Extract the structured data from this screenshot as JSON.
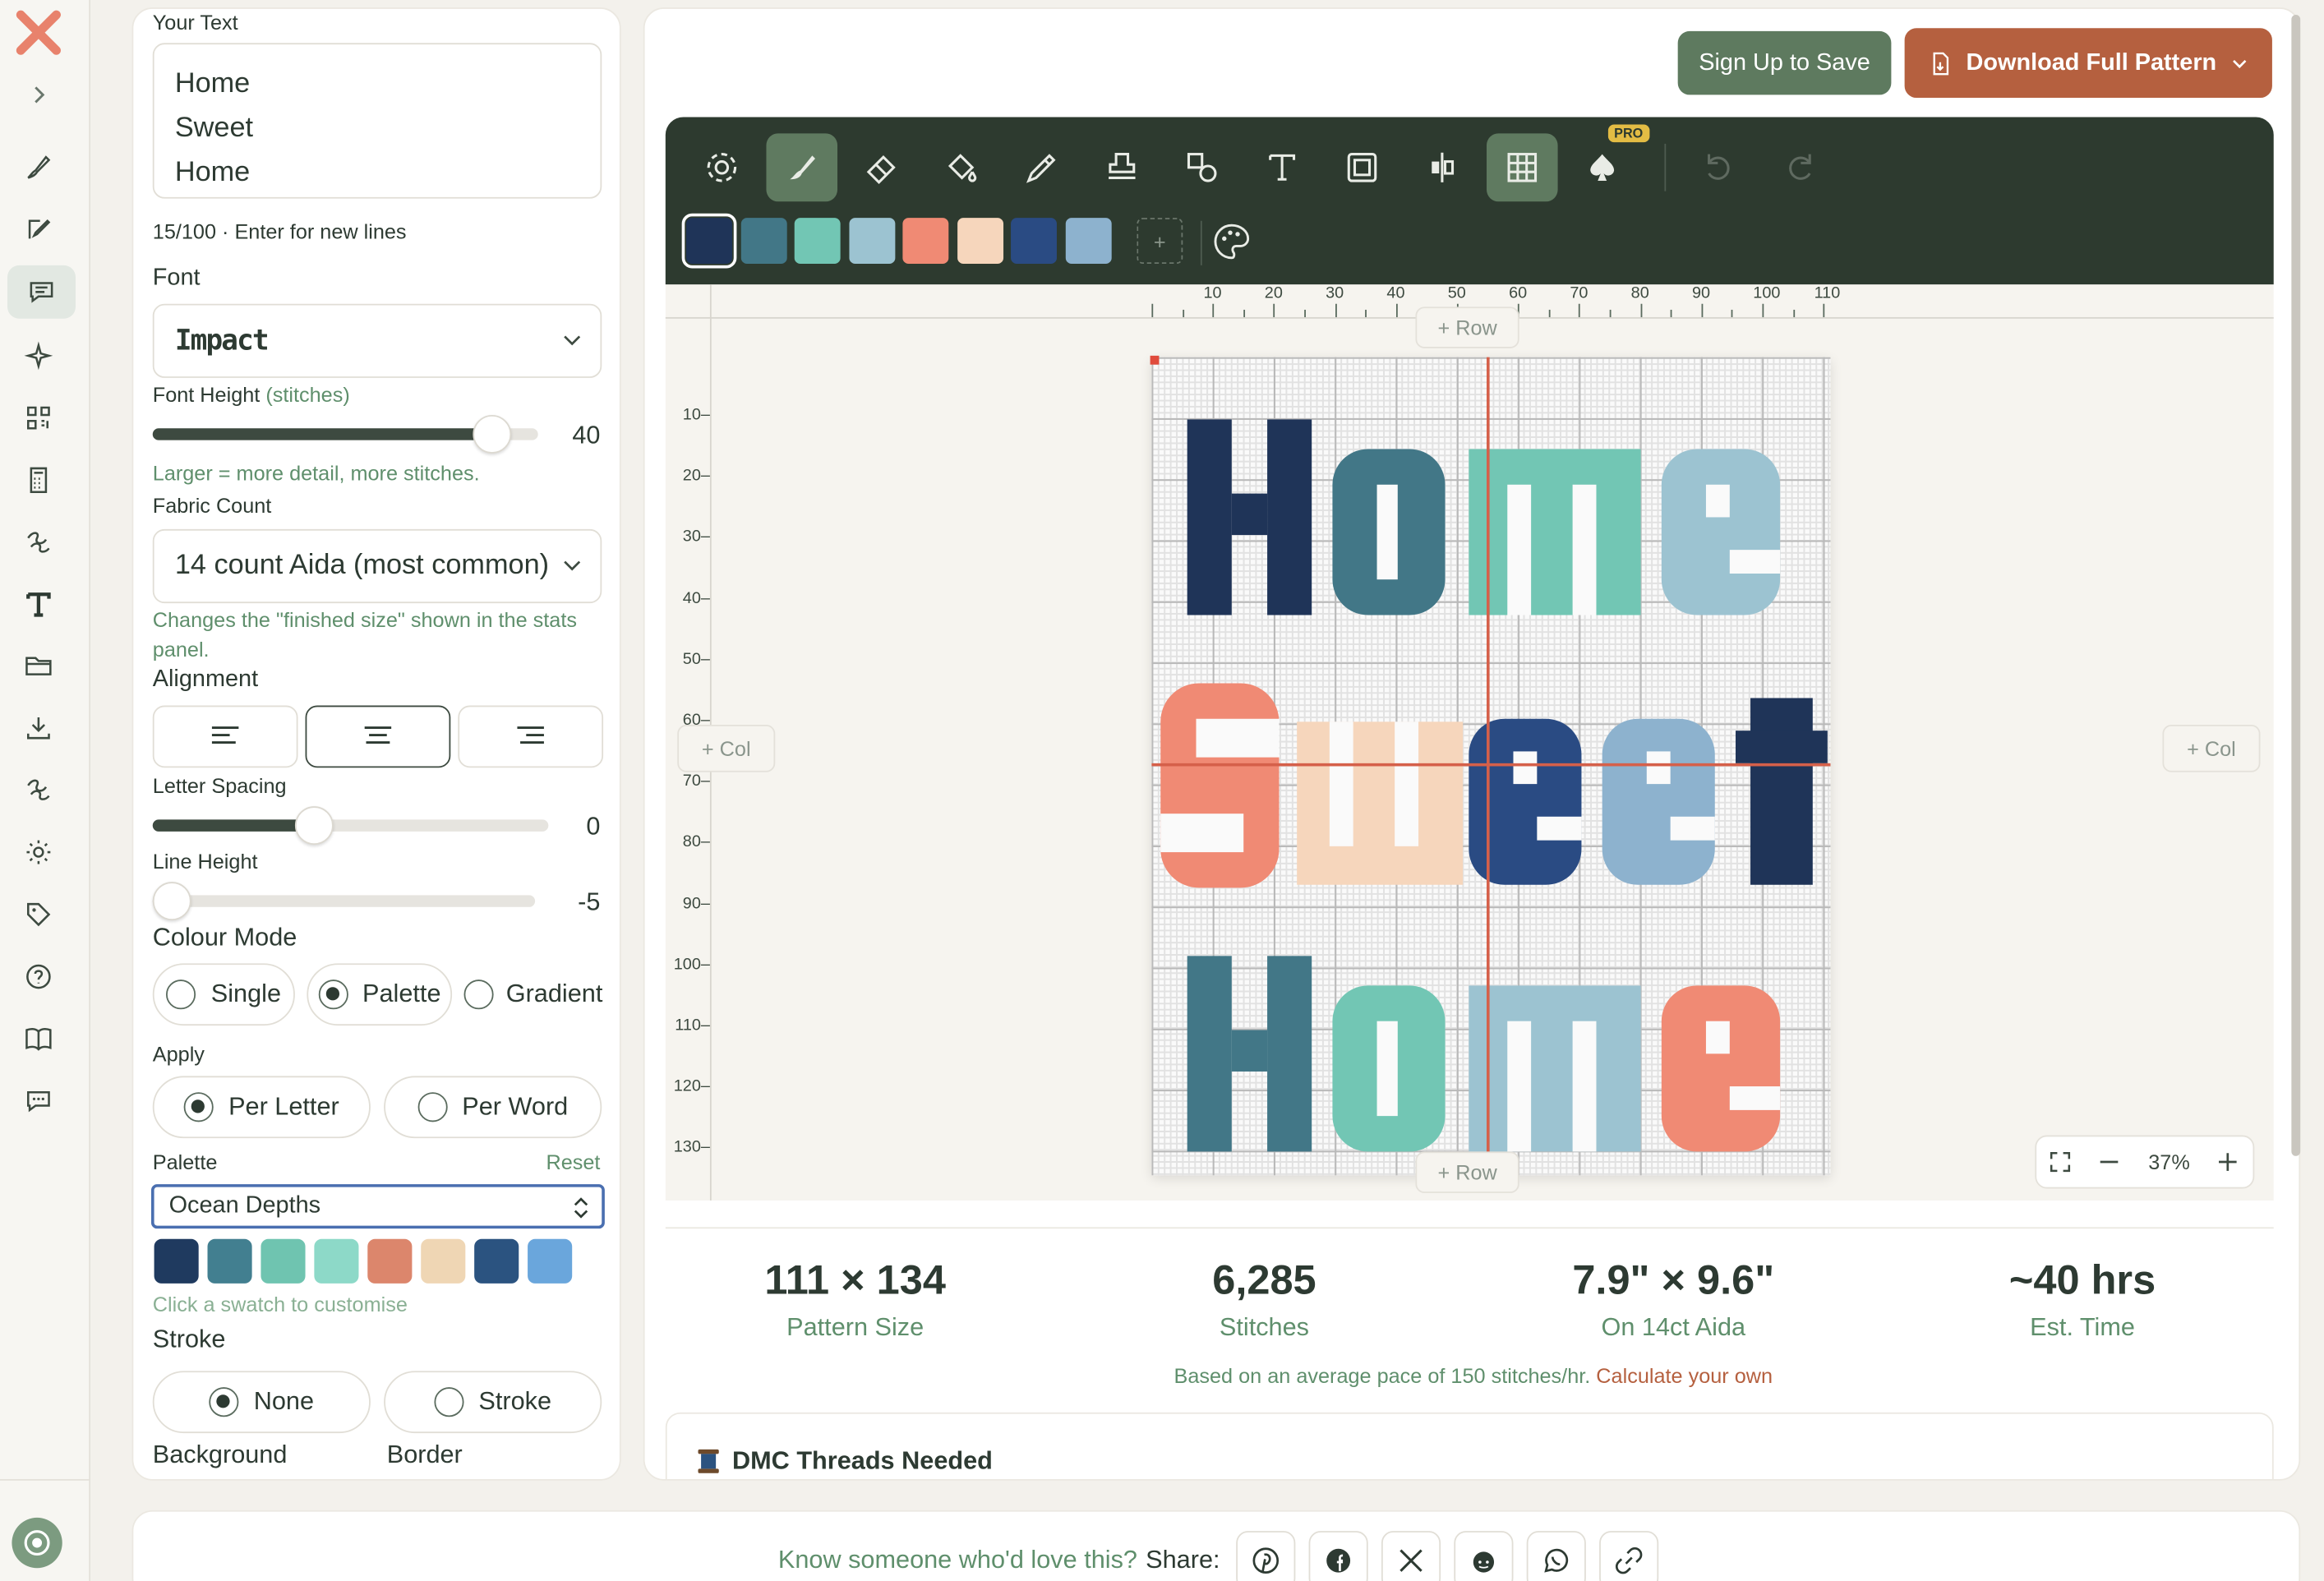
{
  "colors": {
    "accent": "#5e7a5f",
    "brand": "#b5603f",
    "toolbar": "#2d3a2f",
    "hint": "#5f8f6c"
  },
  "rail": {
    "icons": [
      "logo-icon",
      "expand-chevron-icon",
      "brush-icon",
      "edit-icon",
      "chat-text-icon",
      "sparkle-icon",
      "qr-grid-icon",
      "calculator-icon",
      "thread-icon",
      "text-icon",
      "folder-icon",
      "download-icon",
      "thread-icon",
      "settings-icon",
      "tag-icon",
      "help-icon",
      "book-icon",
      "feedback-icon",
      "profile-icon"
    ]
  },
  "panel": {
    "your_text_label": "Your Text",
    "text_value": "Home\nSweet\nHome",
    "char_count": "15/100 · Enter for new lines",
    "font_label": "Font",
    "font_value": "Impact",
    "font_height_label": "Font Height",
    "font_height_unit": "(stitches)",
    "font_height_value": "40",
    "font_height_level": 0.88,
    "font_height_hint": "Larger = more detail, more stitches.",
    "fabric_label": "Fabric Count",
    "fabric_value": "14 count Aida (most common)",
    "fabric_hint": "Changes the \"finished size\" shown in the stats panel.",
    "alignment_label": "Alignment",
    "alignment_selected": "center",
    "letter_spacing_label": "Letter Spacing",
    "letter_spacing_value": "0",
    "letter_spacing_level": 0.41,
    "line_height_label": "Line Height",
    "line_height_value": "-5",
    "line_height_level": 0.05,
    "colour_mode_label": "Colour Mode",
    "colour_modes": [
      "Single",
      "Palette",
      "Gradient"
    ],
    "colour_mode_selected": "Palette",
    "apply_label": "Apply",
    "apply_options": [
      "Per Letter",
      "Per Word"
    ],
    "apply_selected": "Per Letter",
    "palette_label": "Palette",
    "palette_reset": "Reset",
    "palette_value": "Ocean Depths",
    "palette_swatches": [
      "#1f3a5f",
      "#427f90",
      "#6fc4b0",
      "#8dd9c8",
      "#dc866c",
      "#efd6b4",
      "#2b5380",
      "#6aa6dc"
    ],
    "palette_hint": "Click a swatch to customise",
    "stroke_label": "Stroke",
    "stroke_options": [
      "None",
      "Stroke"
    ],
    "stroke_selected": "None",
    "background_label": "Background",
    "border_label": "Border"
  },
  "header": {
    "signup_label": "Sign Up to Save",
    "download_label": "Download Full Pattern"
  },
  "toolbar": {
    "pro_badge": "PRO",
    "swatches": [
      "#1f3458",
      "#427787",
      "#72c6b4",
      "#9cc3d1",
      "#f08a74",
      "#f6d6bc",
      "#2a4b83",
      "#8db2ce"
    ],
    "add_swatch": "+"
  },
  "canvas": {
    "h_ticks": [
      "10",
      "20",
      "30",
      "40",
      "50",
      "60",
      "70",
      "80",
      "90",
      "100",
      "110"
    ],
    "v_ticks": [
      "10",
      "20",
      "30",
      "40",
      "50",
      "60",
      "70",
      "80",
      "90",
      "100",
      "110",
      "120",
      "130"
    ],
    "add_row": "+ Row",
    "add_col": "+ Col",
    "pattern_lines": [
      "Home",
      "Sweet",
      "Home"
    ],
    "zoom": "37%"
  },
  "stats": [
    {
      "value": "111 × 134",
      "caption": "Pattern Size"
    },
    {
      "value": "6,285",
      "caption": "Stitches"
    },
    {
      "value": "7.9\" × 9.6\"",
      "caption": "On 14ct Aida"
    },
    {
      "value": "~40 hrs",
      "caption": "Est. Time"
    }
  ],
  "pace_text": "Based on an average pace of 150 stitches/hr.",
  "pace_link": "Calculate your own",
  "threads_title": "DMC Threads Needed",
  "share": {
    "prompt": "Know someone who'd love this?",
    "label": "Share:"
  }
}
